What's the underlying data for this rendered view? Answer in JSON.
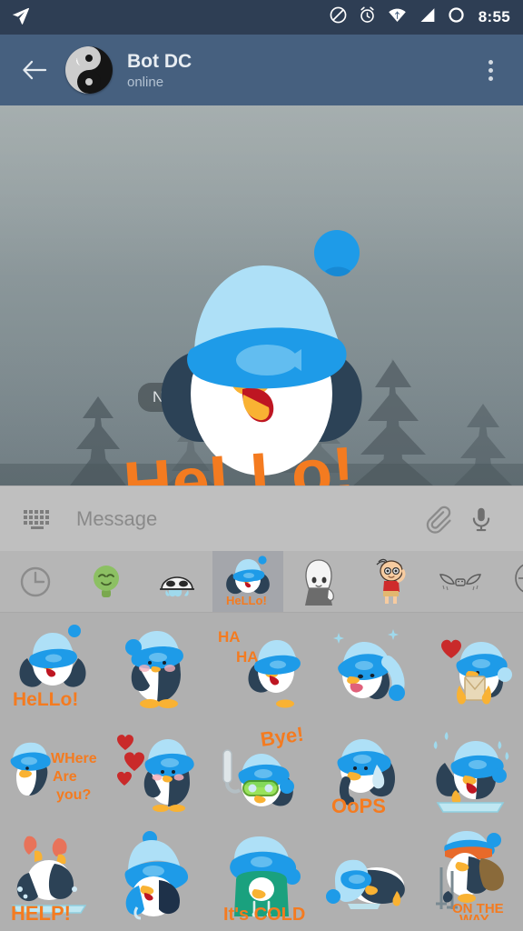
{
  "statusbar": {
    "time": "8:55",
    "icons": [
      "telegram-send-icon",
      "do-not-disturb-icon",
      "alarm-icon",
      "wifi-icon",
      "signal-icon",
      "battery-icon"
    ]
  },
  "toolbar": {
    "back_icon": "back-arrow-icon",
    "avatar_icon": "yin-yang-avatar",
    "title": "Bot DC",
    "subtitle": "online",
    "menu_icon": "overflow-menu-icon"
  },
  "chat": {
    "date_chip": "No",
    "sticker": {
      "name": "penguin-hello-sticker",
      "caption": "HeLLo!",
      "caption_color": "#F47B20",
      "hat_color": "#1E9BE8",
      "hat_top_color": "#AEE0F7",
      "body_color": "#2C4256"
    }
  },
  "input": {
    "keyboard_icon": "keyboard-icon",
    "placeholder": "Message",
    "value": "",
    "attach_icon": "paperclip-icon",
    "mic_icon": "microphone-icon"
  },
  "sticker_tabs": {
    "selected_index": 3,
    "items": [
      {
        "name": "recent-stickers-tab",
        "icon": "clock-icon",
        "label": "Recent"
      },
      {
        "name": "sticker-pack-green-blob",
        "icon": "green-blob-icon",
        "label": "Green blob pack"
      },
      {
        "name": "sticker-pack-crying-face",
        "icon": "crying-face-icon",
        "label": "Crying face pack"
      },
      {
        "name": "sticker-pack-penguin",
        "icon": "penguin-hello-icon",
        "label": "Penguin pack"
      },
      {
        "name": "sticker-pack-anime-girl",
        "icon": "anime-girl-icon",
        "label": "Anime girl pack"
      },
      {
        "name": "sticker-pack-shinchan",
        "icon": "shinchan-icon",
        "label": "Shinchan pack"
      },
      {
        "name": "sticker-pack-wings",
        "icon": "winged-eyes-icon",
        "label": "Winged eyes pack"
      },
      {
        "name": "sticker-pack-round-face",
        "icon": "round-face-icon",
        "label": "Round face pack"
      }
    ]
  },
  "sticker_grid": {
    "rows": [
      [
        {
          "name": "sticker-hello",
          "caption": "HeLLo!",
          "pose": "waving"
        },
        {
          "name": "sticker-plain",
          "caption": "",
          "pose": "standing"
        },
        {
          "name": "sticker-haha",
          "caption": "HA HA",
          "pose": "laughing"
        },
        {
          "name": "sticker-snow",
          "caption": "",
          "pose": "snowflakes"
        },
        {
          "name": "sticker-love-letter",
          "caption": "",
          "pose": "holding-letter"
        }
      ],
      [
        {
          "name": "sticker-where-are-you",
          "caption": "WHere Are you?",
          "pose": "peeking"
        },
        {
          "name": "sticker-hearts",
          "caption": "",
          "pose": "hearts"
        },
        {
          "name": "sticker-bye",
          "caption": "Bye!",
          "pose": "snorkel"
        },
        {
          "name": "sticker-oops",
          "caption": "OoPS",
          "pose": "sweating"
        },
        {
          "name": "sticker-crying-ice",
          "caption": "",
          "pose": "crying-on-ice"
        }
      ],
      [
        {
          "name": "sticker-help",
          "caption": "HELP!",
          "pose": "drowning"
        },
        {
          "name": "sticker-cold-hat",
          "caption": "",
          "pose": "bundled"
        },
        {
          "name": "sticker-its-cold",
          "caption": "It's COLD",
          "pose": "hoodie"
        },
        {
          "name": "sticker-sleeping",
          "caption": "",
          "pose": "lying-down"
        },
        {
          "name": "sticker-on-the-way",
          "caption": "ON THE WAY",
          "pose": "skiing"
        }
      ]
    ]
  },
  "colors": {
    "statusbar": "#2e3e54",
    "toolbar": "#46607f",
    "panel": "#b6b6b6",
    "grid": "#b0b0b0",
    "accent_orange": "#F47B20",
    "penguin_blue": "#1E9BE8",
    "penguin_light_blue": "#AEE0F7",
    "penguin_dark": "#2C4256"
  }
}
